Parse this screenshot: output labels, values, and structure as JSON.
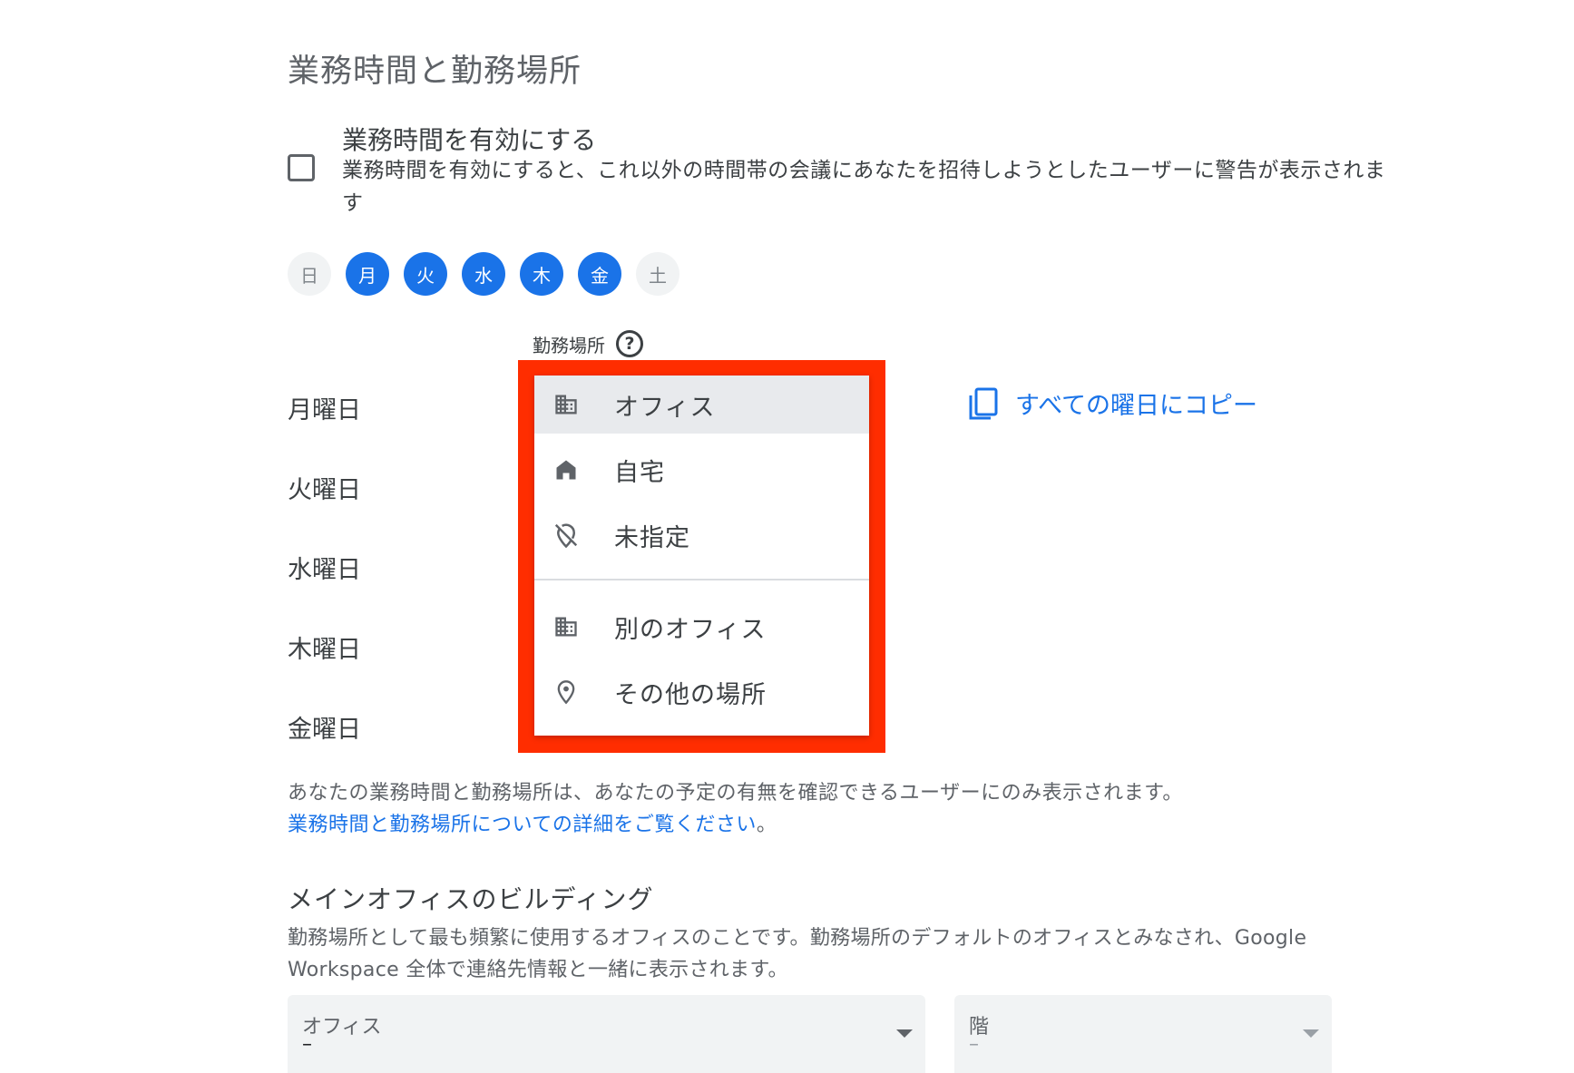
{
  "section": {
    "title": "業務時間と勤務場所"
  },
  "working_hours": {
    "checked": false,
    "title": "業務時間を有効にする",
    "description": "業務時間を有効にすると、これ以外の時間帯の会議にあなたを招待しようとしたユーザーに警告が表示されます"
  },
  "days": [
    {
      "label": "日",
      "active": false
    },
    {
      "label": "月",
      "active": true
    },
    {
      "label": "火",
      "active": true
    },
    {
      "label": "水",
      "active": true
    },
    {
      "label": "木",
      "active": true
    },
    {
      "label": "金",
      "active": true
    },
    {
      "label": "土",
      "active": false
    }
  ],
  "location_column": {
    "label": "勤務場所",
    "help_icon": "help-circle-icon"
  },
  "weekdays": [
    "月曜日",
    "火曜日",
    "水曜日",
    "木曜日",
    "金曜日"
  ],
  "copy_link": {
    "label": "すべての曜日にコピー",
    "icon": "copy-icon"
  },
  "menu": {
    "items": [
      {
        "label": "オフィス",
        "icon": "office-building-icon",
        "selected": true
      },
      {
        "label": "自宅",
        "icon": "home-icon",
        "selected": false
      },
      {
        "label": "未指定",
        "icon": "location-off-icon",
        "selected": false
      },
      {
        "label": "別のオフィス",
        "icon": "office-building-icon",
        "selected": false
      },
      {
        "label": "その他の場所",
        "icon": "location-pin-icon",
        "selected": false
      }
    ]
  },
  "note": {
    "text": "あなたの業務時間と勤務場所は、あなたの予定の有無を確認できるユーザーにのみ表示されます。",
    "link": "業務時間と勤務場所についての詳細をご覧ください",
    "link_suffix": "。"
  },
  "building": {
    "title": "メインオフィスのビルディング",
    "description": "勤務場所として最も頻繁に使用するオフィスのことです。勤務場所のデフォルトのオフィスとみなされ、Google Workspace 全体で連絡先情報と一緒に表示されます。",
    "office_select": {
      "label": "オフィス",
      "value": "–"
    },
    "floor_select": {
      "label": "階",
      "value": "–"
    }
  },
  "colors": {
    "accent": "#1a73e8",
    "highlight": "#ff2d00"
  }
}
